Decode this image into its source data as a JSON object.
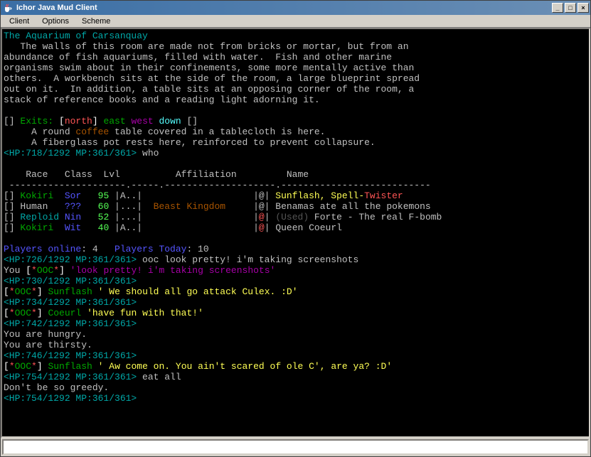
{
  "window": {
    "title": "Ichor Java Mud Client"
  },
  "menu": {
    "client": "Client",
    "options": "Options",
    "scheme": "Scheme"
  },
  "btn": {
    "min": "_",
    "max": "□",
    "close": "×"
  },
  "room": {
    "title": "The Aquarium of Carsanquay",
    "desc1": "   The walls of this room are made not from bricks or mortar, but from an",
    "desc2": "abundance of fish aquariums, filled with water.  Fish and other marine",
    "desc3": "organisms swim about in their confinements, some more mentally active than",
    "desc4": "others.  A workbench sits at the side of the room, a large blueprint spread",
    "desc5": "out on it.  In addition, a table sits at an opposing corner of the room, a",
    "desc6": "stack of reference books and a reading light adorning it."
  },
  "exits": {
    "lb": "[] ",
    "label": "Exits: ",
    "lbr": "[",
    "north": "north",
    "rbr": "] ",
    "east": "east ",
    "west": "west ",
    "down": "down",
    "tail": " []"
  },
  "items": {
    "l1a": "     A round ",
    "coffee": "coffee",
    "l1b": " table covered in a tablecloth is here.",
    "l2": "     A fiberglass pot rests here, reinforced to prevent collapsure."
  },
  "prompts": {
    "p1": "<HP:718/1292 MP:361/361>",
    "p1cmd": " who",
    "p2": "<HP:726/1292 MP:361/361>",
    "p2cmd": " ooc look pretty! i'm taking screenshots",
    "p3": "<HP:730/1292 MP:361/361>",
    "p4": "<HP:734/1292 MP:361/361>",
    "p5": "<HP:742/1292 MP:361/361>",
    "p6": "<HP:746/1292 MP:361/361>",
    "p7": "<HP:754/1292 MP:361/361>",
    "p7cmd": " eat all",
    "p8": "<HP:754/1292 MP:361/361>"
  },
  "who": {
    "header": "    Race   Class  Lvl          Affiliation         Name",
    "rule": " ---------------------.-----.--------------------.---------------------------",
    "r1lb": "[] ",
    "r1race": "Kokiri  ",
    "r1cls": "Sor   ",
    "r1lvl": "95 ",
    "r1f": "|A..|                    |@| ",
    "r1n1": "Sunflash, Spell-",
    "r1n2": "Twister",
    "r2lb": "[] ",
    "r2race": "Human   ",
    "r2cls": "???   ",
    "r2lvl": "60 ",
    "r2fa": "|...|  ",
    "r2aff": "Beast Kingdom",
    "r2fb": "     |@| ",
    "r2n": "Benamas ate all the pokemons",
    "r3lb": "[] ",
    "r3race": "Reploid ",
    "r3cls": "Nin   ",
    "r3lvl": "52 ",
    "r3f": "|...|                    |",
    "r3at": "@",
    "r3fb": "| ",
    "r3used": "(Used)",
    "r3n": " Forte - The real F-bomb",
    "r4lb": "[] ",
    "r4race": "Kokiri  ",
    "r4cls": "Wit   ",
    "r4lvl": "40 ",
    "r4f": "|A..|                    |",
    "r4at": "@",
    "r4fb": "| ",
    "r4n": "Queen Coeurl"
  },
  "online": {
    "a": "Players online",
    "b": ": 4   ",
    "c": "Players Today",
    "d": ": 10"
  },
  "ooc": {
    "you": "You ",
    "lbr": "[",
    "star": "*",
    "tag": "OOC",
    "rbr": "] ",
    "msg1": "'look pretty! i'm taking screenshots'",
    "sun": "Sunflash ",
    "msg2": "' We should all go attack Culex. :D'",
    "coe": "Coeurl ",
    "msg3": "'have fun with that!'",
    "msg4": "' Aw come on. You ain't scared of ole C', are ya? :D'"
  },
  "status": {
    "hungry": "You are hungry.",
    "thirsty": "You are thirsty.",
    "greedy": "Don't be so greedy."
  },
  "input": {
    "value": ""
  }
}
